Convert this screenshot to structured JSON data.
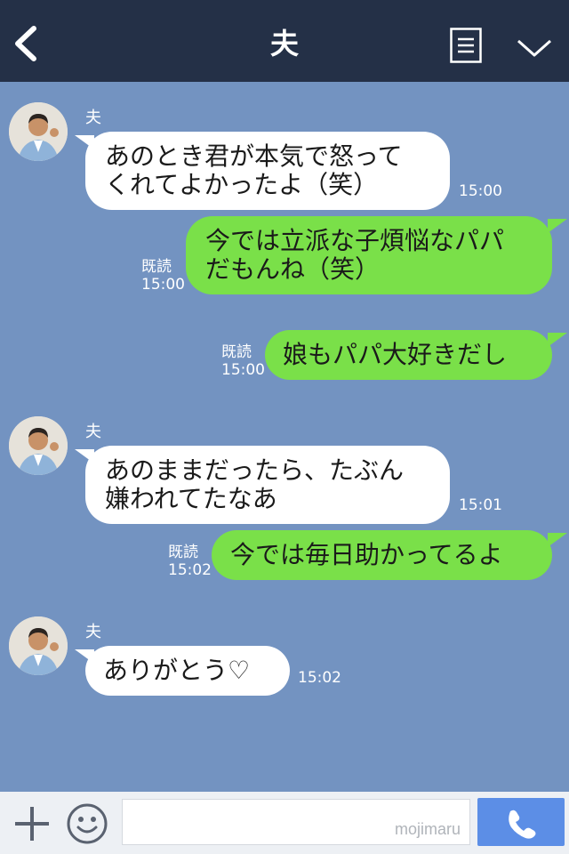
{
  "header": {
    "title": "夫"
  },
  "colors": {
    "header_bg": "#243047",
    "chat_bg": "#7393c1",
    "outgoing_bubble": "#7ae049",
    "incoming_bubble": "#ffffff",
    "call_button": "#5c8ee6"
  },
  "icons": {
    "back": "chevron-left-icon",
    "menu": "notes-icon",
    "collapse": "chevron-down-icon",
    "add": "plus-icon",
    "emoji": "smiley-icon",
    "call": "phone-icon"
  },
  "messages": [
    {
      "direction": "in",
      "sender": "夫",
      "text": "あのとき君が本気で怒って\nくれてよかったよ（笑）",
      "time": "15:00"
    },
    {
      "direction": "out",
      "status": "既読",
      "text": "今では立派な子煩悩なパパ\nだもんね（笑）",
      "time": "15:00"
    },
    {
      "direction": "out",
      "status": "既読",
      "text": "娘もパパ大好きだし",
      "time": "15:00"
    },
    {
      "direction": "in",
      "sender": "夫",
      "text": "あのままだったら、たぶん\n嫌われてたなあ",
      "time": "15:01"
    },
    {
      "direction": "out",
      "status": "既読",
      "text": "今では毎日助かってるよ",
      "time": "15:02"
    },
    {
      "direction": "in",
      "sender": "夫",
      "text": "ありがとう♡",
      "time": "15:02"
    }
  ],
  "footer": {
    "input_value": "",
    "watermark": "mojimaru"
  }
}
